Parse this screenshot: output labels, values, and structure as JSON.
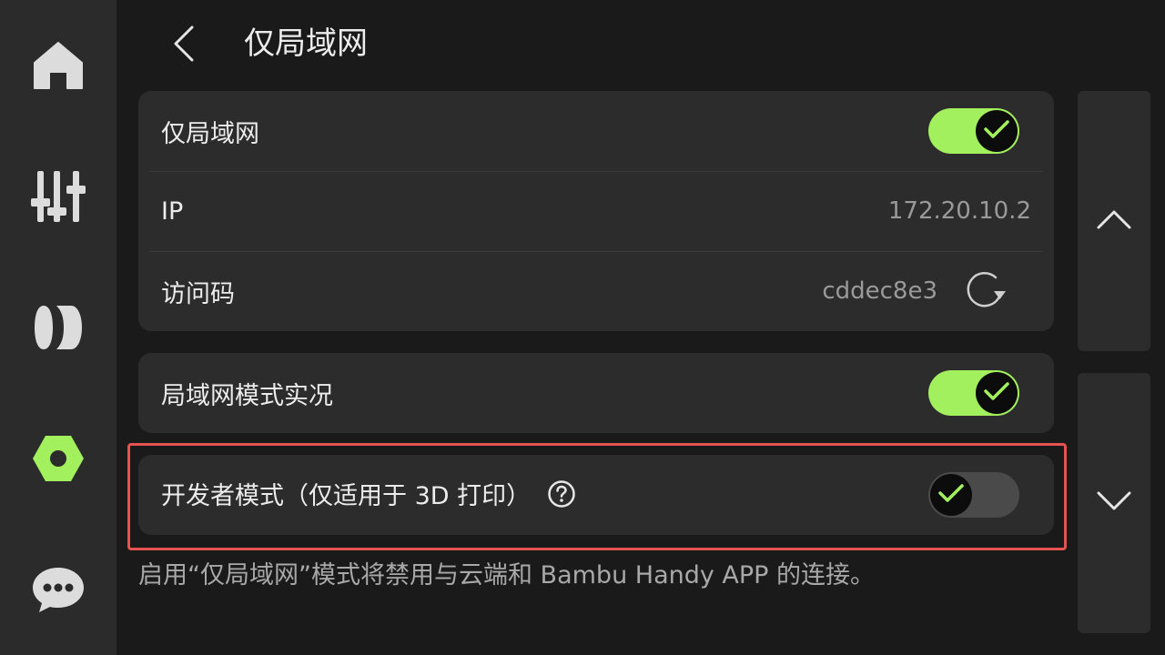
{
  "sidebar": {
    "items": [
      {
        "icon": "home-icon",
        "active": false
      },
      {
        "icon": "sliders-icon",
        "active": false
      },
      {
        "icon": "filament-icon",
        "active": false
      },
      {
        "icon": "settings-hex-icon",
        "active": true
      },
      {
        "icon": "chat-icon",
        "active": false
      }
    ]
  },
  "colors": {
    "accent": "#a3f05f",
    "highlight_border": "#e4534f",
    "card_bg": "#2c2c2c",
    "page_bg": "#1a1a1a",
    "sidebar_bg": "#2b2b2b"
  },
  "header": {
    "title": "仅局域网",
    "back_icon": "chevron-left-icon"
  },
  "lan_card": {
    "lan_only": {
      "label": "仅局域网",
      "enabled": true
    },
    "ip": {
      "label": "IP",
      "value": "172.20.10.2"
    },
    "access_code": {
      "label": "访问码",
      "value": "cddec8e3",
      "refresh_icon": "refresh-icon"
    }
  },
  "liveview_card": {
    "label": "局域网模式实况",
    "enabled": true
  },
  "developer_card": {
    "label": "开发者模式（仅适用于 3D 打印）",
    "help_icon": "help-circle-icon",
    "enabled": false
  },
  "note": "启用“仅局域网”模式将禁用与云端和 Bambu Handy APP 的连接。",
  "scroll": {
    "up_icon": "chevron-up-icon",
    "down_icon": "chevron-down-icon"
  }
}
